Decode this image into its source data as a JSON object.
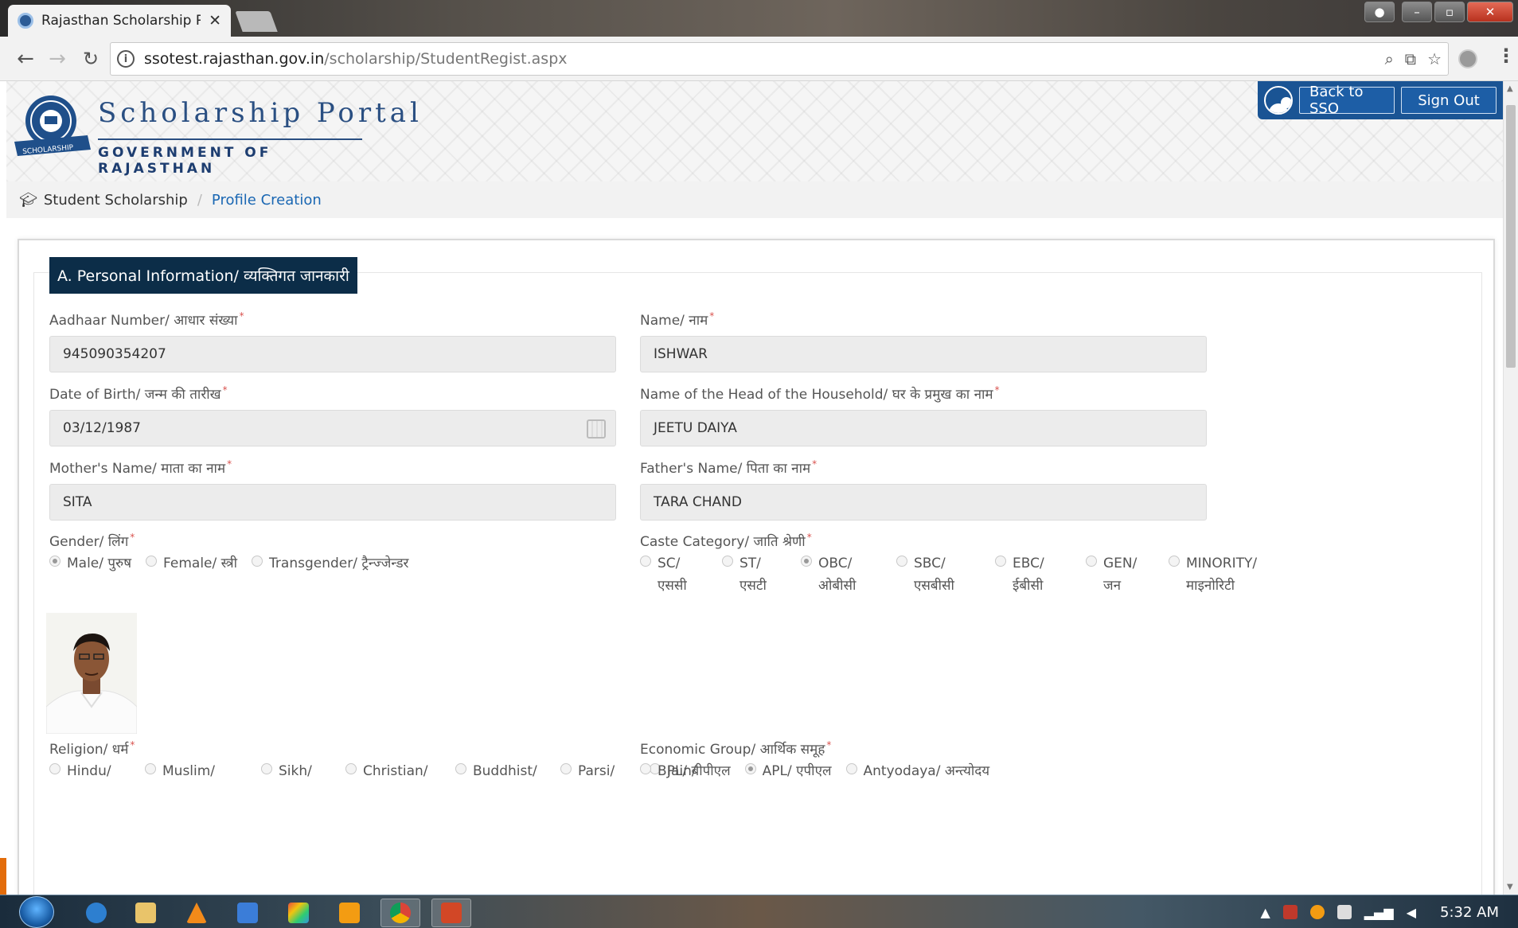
{
  "browser": {
    "tab_title": "Rajasthan Scholarship Po",
    "tab_close": "✕",
    "url_host": "ssotest.rajasthan.gov.in",
    "url_path": "/scholarship/StudentRegist.aspx",
    "window_controls": {
      "minimize": "–",
      "maximize": "▫",
      "close": "✕"
    }
  },
  "header": {
    "portal_title": "Scholarship Portal",
    "portal_subtitle": "GOVERNMENT OF RAJASTHAN",
    "emblem_text": "SCHOLARSHIP",
    "back_to_sso": "Back to SSO",
    "sign_out": "Sign Out"
  },
  "breadcrumb": {
    "home": "Student Scholarship",
    "separator": "/",
    "current": "Profile Creation"
  },
  "section": {
    "title": "A. Personal Information/ व्यक्तिगत जानकारी"
  },
  "form": {
    "aadhaar": {
      "label": "Aadhaar Number/ आधार संख्या",
      "value": "945090354207"
    },
    "name": {
      "label": "Name/ नाम",
      "value": "ISHWAR"
    },
    "dob": {
      "label": "Date of Birth/ जन्म की तारीख",
      "value": "03/12/1987"
    },
    "head_of_household": {
      "label": "Name of the Head of the Household/ घर के प्रमुख का नाम",
      "value": "JEETU DAIYA"
    },
    "mother_name": {
      "label": "Mother's Name/ माता का नाम",
      "value": "SITA"
    },
    "father_name": {
      "label": "Father's Name/ पिता का नाम",
      "value": "TARA CHAND"
    },
    "required_mark": "*",
    "gender": {
      "label": "Gender/ लिंग",
      "options": [
        "Male/ पुरुष",
        "Female/ स्त्री",
        "Transgender/ ट्रैन्ज्जेन्डर"
      ],
      "selected": "Male/ पुरुष"
    },
    "caste": {
      "label": "Caste Category/ जाति श्रेणी",
      "options": [
        {
          "line1": "SC/",
          "line2": "एससी"
        },
        {
          "line1": "ST/",
          "line2": "एसटी"
        },
        {
          "line1": "OBC/",
          "line2": "ओबीसी"
        },
        {
          "line1": "SBC/",
          "line2": "एसबीसी"
        },
        {
          "line1": "EBC/",
          "line2": "ईबीसी"
        },
        {
          "line1": "GEN/",
          "line2": "जन"
        },
        {
          "line1": "MINORITY/",
          "line2": "माइनोरिटी"
        }
      ],
      "selected": "OBC/"
    },
    "religion": {
      "label": "Religion/ धर्म",
      "options": [
        "Hindu/",
        "Muslim/",
        "Sikh/",
        "Christian/",
        "Buddhist/",
        "Parsi/",
        "Jain/"
      ]
    },
    "economic_group": {
      "label": "Economic Group/ आर्थिक समूह",
      "options": [
        "BPL/ बीपीएल",
        "APL/ एपीएल",
        "Antyodaya/ अन्त्योदय"
      ],
      "selected": "APL/ एपीएल"
    }
  },
  "taskbar": {
    "clock": "5:32 AM"
  },
  "colors": {
    "header_blue": "#1a5494",
    "section_tab_bg": "#0c2d48",
    "link_blue": "#1a67b3",
    "required_red": "#d9534f"
  }
}
